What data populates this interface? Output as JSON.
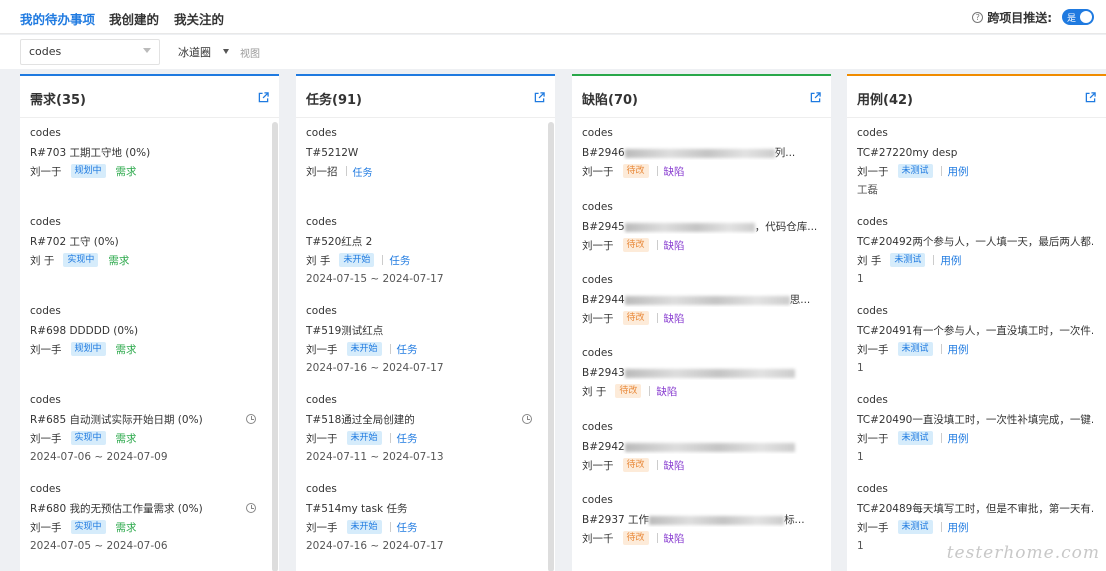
{
  "tabs": [
    {
      "label": "我的待办事项",
      "active": true
    },
    {
      "label": "我创建的",
      "active": false
    },
    {
      "label": "我关注的",
      "active": false
    }
  ],
  "cross_push": {
    "label": "跨项目推送:",
    "toggle_text": "是",
    "enabled": true
  },
  "filters": {
    "project_select": "codes",
    "user": "冰道圈",
    "view_label": "视图"
  },
  "columns": [
    {
      "title": "需求(35)",
      "accent": "#1f7ae0",
      "cards": [
        {
          "project": "codes",
          "title": "R#703 工期工守地  (0%)",
          "assignee": "刘一于",
          "status": "规划中",
          "type": "需求"
        },
        {
          "project": "codes",
          "title": "R#702 工守  (0%)",
          "assignee": "刘  于",
          "status": "实现中",
          "type": "需求"
        },
        {
          "project": "codes",
          "title": "R#698 DDDDD  (0%)",
          "assignee": "刘一手",
          "status": "规划中",
          "type": "需求"
        },
        {
          "project": "codes",
          "title": "R#685 自动测试实际开始日期  (0%)",
          "assignee": "刘一手",
          "status": "实现中",
          "type": "需求",
          "date": "2024-07-06 ~ 2024-07-09",
          "clock": true
        },
        {
          "project": "codes",
          "title": "R#680 我的无预估工作量需求  (0%)",
          "assignee": "刘一手",
          "status": "实现中",
          "type": "需求",
          "date": "2024-07-05 ~ 2024-07-06",
          "clock": true
        }
      ]
    },
    {
      "title": "任务(91)",
      "accent": "#1f7ae0",
      "cards": [
        {
          "project": "codes",
          "title": "T#5212W",
          "assignee": "刘一招",
          "type": "任务"
        },
        {
          "project": "codes",
          "title": "T#520红点 2",
          "assignee": "刘  手",
          "status": "未开始",
          "type": "任务",
          "date": "2024-07-15 ~ 2024-07-17"
        },
        {
          "project": "codes",
          "title": "T#519测试红点",
          "assignee": "刘一手",
          "status": "未开始",
          "type": "任务",
          "date": "2024-07-16 ~ 2024-07-17"
        },
        {
          "project": "codes",
          "title": "T#518通过全局创建的",
          "assignee": "刘一于",
          "status": "未开始",
          "type": "任务",
          "date": "2024-07-11 ~ 2024-07-13",
          "clock": true
        },
        {
          "project": "codes",
          "title": "T#514my task 任务",
          "assignee": "刘一手",
          "status": "未开始",
          "type": "任务",
          "date": "2024-07-16 ~ 2024-07-17"
        }
      ]
    },
    {
      "title": "缺陷(70)",
      "accent": "#2aa84a",
      "cards": [
        {
          "project": "codes",
          "title_prefix": "B#2946",
          "title_suffix": "列...",
          "assignee": "刘一于",
          "status": "待改",
          "type": "缺陷"
        },
        {
          "project": "codes",
          "title_prefix": "B#2945",
          "title_suffix": "，代码仓库...",
          "assignee": "刘一于",
          "status": "待改",
          "type": "缺陷"
        },
        {
          "project": "codes",
          "title_prefix": "B#2944",
          "title_suffix": "思...",
          "assignee": "刘一于",
          "status": "待改",
          "type": "缺陷"
        },
        {
          "project": "codes",
          "title_prefix": "B#2943",
          "title_suffix": "",
          "assignee": "刘  于",
          "status": "待改",
          "type": "缺陷"
        },
        {
          "project": "codes",
          "title_prefix": "B#2942",
          "title_suffix": "",
          "assignee": "刘一于",
          "status": "待改",
          "type": "缺陷"
        },
        {
          "project": "codes",
          "title_prefix": "B#2937 工作",
          "title_suffix": "标...",
          "assignee": "刘一千",
          "status": "待改",
          "type": "缺陷"
        }
      ]
    },
    {
      "title": "用例(42)",
      "accent": "#f08c00",
      "cards": [
        {
          "project": "codes",
          "title": "TC#27220my desp",
          "assignee": "刘一于",
          "status": "未测试",
          "type": "用例",
          "extra": "工磊"
        },
        {
          "project": "codes",
          "title": "TC#20492两个参与人，一人填一天，最后两人都...",
          "assignee": "刘  手",
          "status": "未测试",
          "type": "用例",
          "extra": "1"
        },
        {
          "project": "codes",
          "title": "TC#20491有一个参与人，一直没填工时，一次件...",
          "assignee": "刘一手",
          "status": "未测试",
          "type": "用例",
          "extra": "1"
        },
        {
          "project": "codes",
          "title": "TC#20490一直没填工时，一次性补填完成，一键...",
          "assignee": "刘一于",
          "status": "未测试",
          "type": "用例",
          "extra": "1"
        },
        {
          "project": "codes",
          "title": "TC#20489每天填写工时，但是不审批，第一天有...",
          "assignee": "刘一手",
          "status": "未测试",
          "type": "用例",
          "extra": "1"
        }
      ]
    }
  ],
  "watermark": "testerhome.com"
}
